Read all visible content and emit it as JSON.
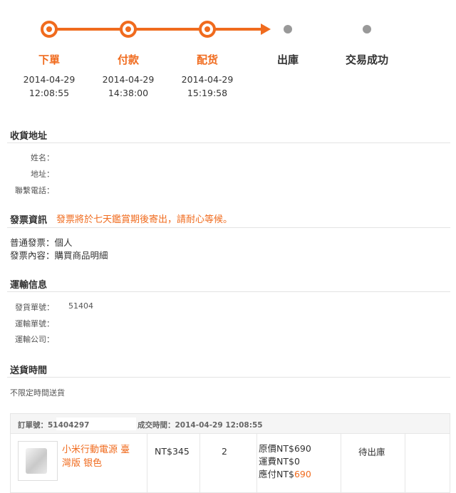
{
  "progress": {
    "steps": [
      {
        "label": "下單",
        "date": "2014-04-29",
        "time": "12:08:55",
        "status": "done"
      },
      {
        "label": "付款",
        "date": "2014-04-29",
        "time": "14:38:00",
        "status": "done"
      },
      {
        "label": "配货",
        "date": "2014-04-29",
        "time": "15:19:58",
        "status": "done"
      },
      {
        "label": "出庫",
        "status": "pending"
      },
      {
        "label": "交易成功",
        "status": "pending"
      }
    ],
    "accent_color": "#f06b1e"
  },
  "shipping_address": {
    "title": "收貨地址",
    "name_label": "姓名：",
    "address_label": "地址：",
    "phone_label": "聯繫電話："
  },
  "invoice": {
    "title": "發票資訊",
    "notice": "發票將於七天鑑賞期後寄出，請耐心等候。",
    "type_line": "普通發票：個人",
    "content_line": "發票內容：購買商品明細"
  },
  "transport": {
    "title": "運輸信息",
    "delivery_no_label": "發貨單號：",
    "delivery_no_value": "51404",
    "tracking_no_label": "運輸單號：",
    "carrier_label": "運輸公司："
  },
  "delivery_time": {
    "title": "送貨時間",
    "value": "不限定時間送貨"
  },
  "order": {
    "order_no_label": "訂單號：51404297",
    "deal_time_label": "成交時間：2014-04-29 12:08:55",
    "product_name": "小米行動電源 臺灣版 银色",
    "unit_price": "NT$345",
    "quantity": "2",
    "original_price": "原價NT$690",
    "shipping_fee": "運費NT$0",
    "payable_label": "應付NT$",
    "payable_value": "690",
    "status": "待出庫"
  }
}
